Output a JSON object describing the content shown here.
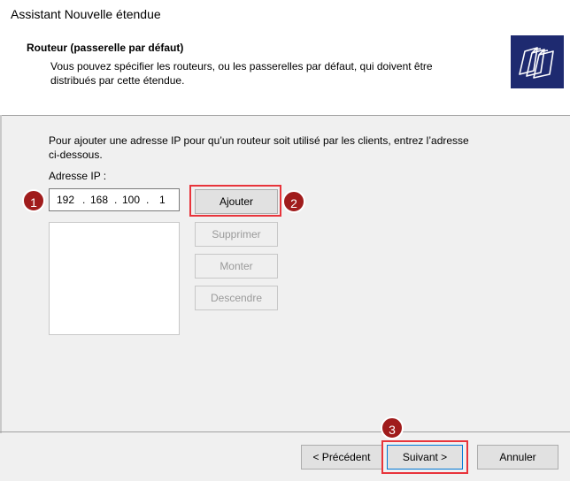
{
  "window": {
    "title": "Assistant Nouvelle étendue"
  },
  "header": {
    "title": "Routeur (passerelle par défaut)",
    "description": "Vous pouvez spécifier les routeurs, ou les passerelles par défaut, qui doivent être distribués par cette étendue.",
    "icon": "folders-icon"
  },
  "main": {
    "intro": "Pour ajouter une adresse IP pour qu’un routeur soit utilisé par les clients, entrez l’adresse ci-dessous.",
    "ip_label": "Adresse IP :",
    "ip": {
      "octet1": "192",
      "octet2": "168",
      "octet3": "100",
      "octet4": "1",
      "dot": "."
    },
    "buttons": {
      "add": "Ajouter",
      "remove": "Supprimer",
      "up": "Monter",
      "down": "Descendre"
    }
  },
  "footer": {
    "prev": "< Précédent",
    "next": "Suivant >",
    "cancel": "Annuler"
  },
  "annotations": {
    "badge1": "1",
    "badge2": "2",
    "badge3": "3",
    "highlight_color": "#e8343b",
    "badge_color": "#a01c1c"
  }
}
